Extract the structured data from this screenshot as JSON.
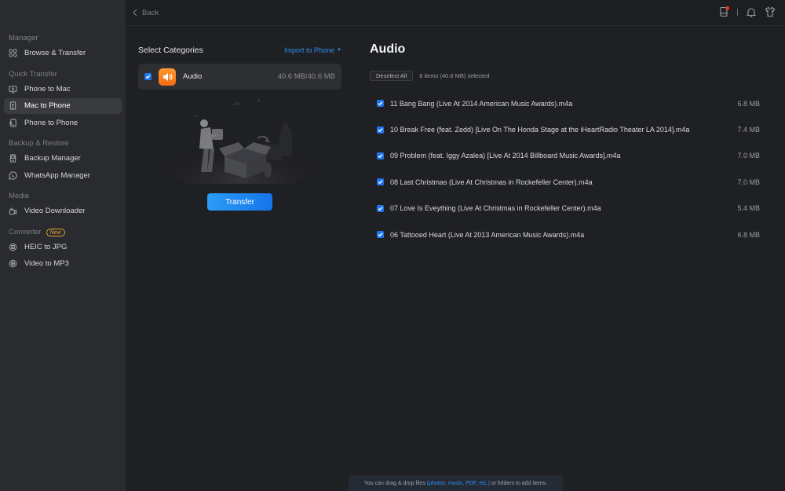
{
  "sidebar": {
    "sections": [
      {
        "title": "Manager",
        "items": [
          {
            "label": "Browse & Transfer",
            "icon": "grid-icon"
          }
        ]
      },
      {
        "title": "Quick Transfer",
        "items": [
          {
            "label": "Phone to Mac",
            "icon": "monitor-download-icon"
          },
          {
            "label": "Mac to Phone",
            "icon": "phone-upload-icon",
            "active": true
          },
          {
            "label": "Phone to Phone",
            "icon": "phone-transfer-icon"
          }
        ]
      },
      {
        "title": "Backup & Restore",
        "items": [
          {
            "label": "Backup Manager",
            "icon": "backup-icon"
          },
          {
            "label": "WhatsApp Manager",
            "icon": "whatsapp-icon"
          }
        ]
      },
      {
        "title": "Media",
        "items": [
          {
            "label": "Video Downloader",
            "icon": "video-download-icon"
          }
        ]
      },
      {
        "title": "Converter",
        "badge": "New",
        "items": [
          {
            "label": "HEIC to JPG",
            "icon": "image-convert-icon"
          },
          {
            "label": "Video to MP3",
            "icon": "video-convert-icon"
          }
        ]
      }
    ]
  },
  "topbar": {
    "back_label": "Back",
    "icons": [
      "device-icon",
      "bell-icon",
      "tshirt-icon"
    ]
  },
  "left_panel": {
    "title": "Select Categories",
    "import_label": "Import to Phone",
    "category": {
      "name": "Audio",
      "size": "40.6 MB/40.6 MB",
      "checked": true,
      "icon_color": "#f57a1c"
    },
    "transfer_label": "Transfer"
  },
  "right_panel": {
    "title": "Audio",
    "deselect_label": "Deselect All",
    "selection_summary": "6 items (40.6 MB) selected",
    "files": [
      {
        "name": "11 Bang Bang (Live At 2014 American Music Awards).m4a",
        "size": "6.8 MB",
        "checked": true
      },
      {
        "name": "10 Break Free (feat. Zedd) [Live On The Honda Stage at the iHeartRadio Theater LA 2014].m4a",
        "size": "7.4 MB",
        "checked": true
      },
      {
        "name": "09 Problem (feat. Iggy Azalea)  [Live At 2014 Billboard Music Awards].m4a",
        "size": "7.0 MB",
        "checked": true
      },
      {
        "name": "08 Last Christmas  (Live At Christmas in Rockefeller Center).m4a",
        "size": "7.0 MB",
        "checked": true
      },
      {
        "name": "07 Love Is Eveything (Live At Christmas in Rockefeller Center).m4a",
        "size": "5.4 MB",
        "checked": true
      },
      {
        "name": "06 Tattooed Heart (Live At 2013 American Music Awards).m4a",
        "size": "6.8 MB",
        "checked": true
      }
    ]
  },
  "hint": {
    "prefix": "You can drag & drop files ",
    "link": "(photos, music, PDF, etc.)",
    "suffix": " or folders to add items."
  },
  "colors": {
    "accent": "#1f74f0",
    "link": "#2f8ff0",
    "badge": "#e8a33d",
    "notification": "#e8332f"
  }
}
